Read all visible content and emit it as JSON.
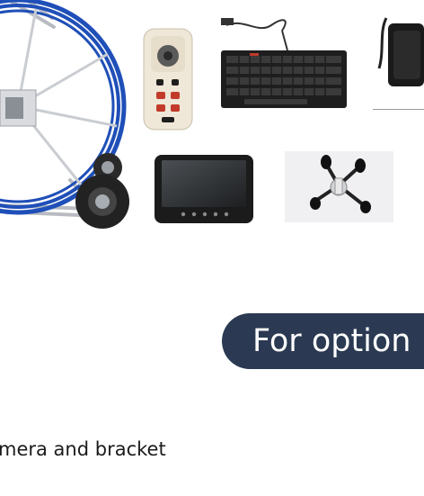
{
  "promo": {
    "option_label": "For option",
    "caption": "mera and bracket"
  },
  "icons": {
    "reel": "cable-reel-cart-icon",
    "remote": "handheld-controller-icon",
    "keyboard": "keyboard-icon",
    "charger": "power-adapter-icon",
    "monitor": "display-monitor-icon",
    "crawler": "crawler-bracket-icon"
  },
  "colors": {
    "pill_background": "#2b3a52",
    "pill_text": "#ffffff",
    "cable_blue": "#1f4fb8",
    "caption_text": "#1b1b1b"
  }
}
